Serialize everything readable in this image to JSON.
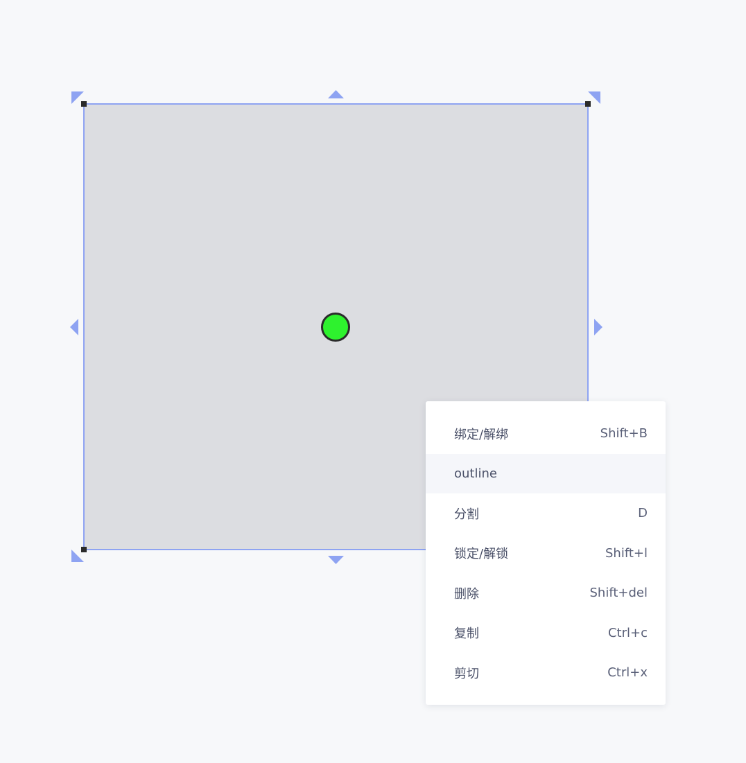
{
  "colors": {
    "background": "#f7f8fa",
    "shape_fill": "#dcdde1",
    "selection": "#8ea3f2",
    "handle": "#2b2b2b",
    "anchor_fill": "#2ef22e",
    "anchor_stroke": "#2b2b2b",
    "menu_bg": "#ffffff",
    "menu_hover": "#f5f6fa",
    "menu_text": "#4a5068"
  },
  "icons": {
    "resize_handles": [
      "triangle-top-left-icon",
      "triangle-top-icon",
      "triangle-top-right-icon",
      "triangle-left-icon",
      "triangle-right-icon",
      "triangle-bottom-left-icon",
      "triangle-bottom-icon"
    ],
    "corner_handles": [
      "square-handle-icon"
    ],
    "anchor": "circle-anchor-icon"
  },
  "context_menu": {
    "highlighted_index": 1,
    "items": [
      {
        "label": "绑定/解绑",
        "shortcut": "Shift+B"
      },
      {
        "label": "outline",
        "shortcut": ""
      },
      {
        "label": "分割",
        "shortcut": "D"
      },
      {
        "label": "锁定/解锁",
        "shortcut": "Shift+l"
      },
      {
        "label": "删除",
        "shortcut": "Shift+del"
      },
      {
        "label": "复制",
        "shortcut": "Ctrl+c"
      },
      {
        "label": "剪切",
        "shortcut": "Ctrl+x"
      }
    ]
  }
}
